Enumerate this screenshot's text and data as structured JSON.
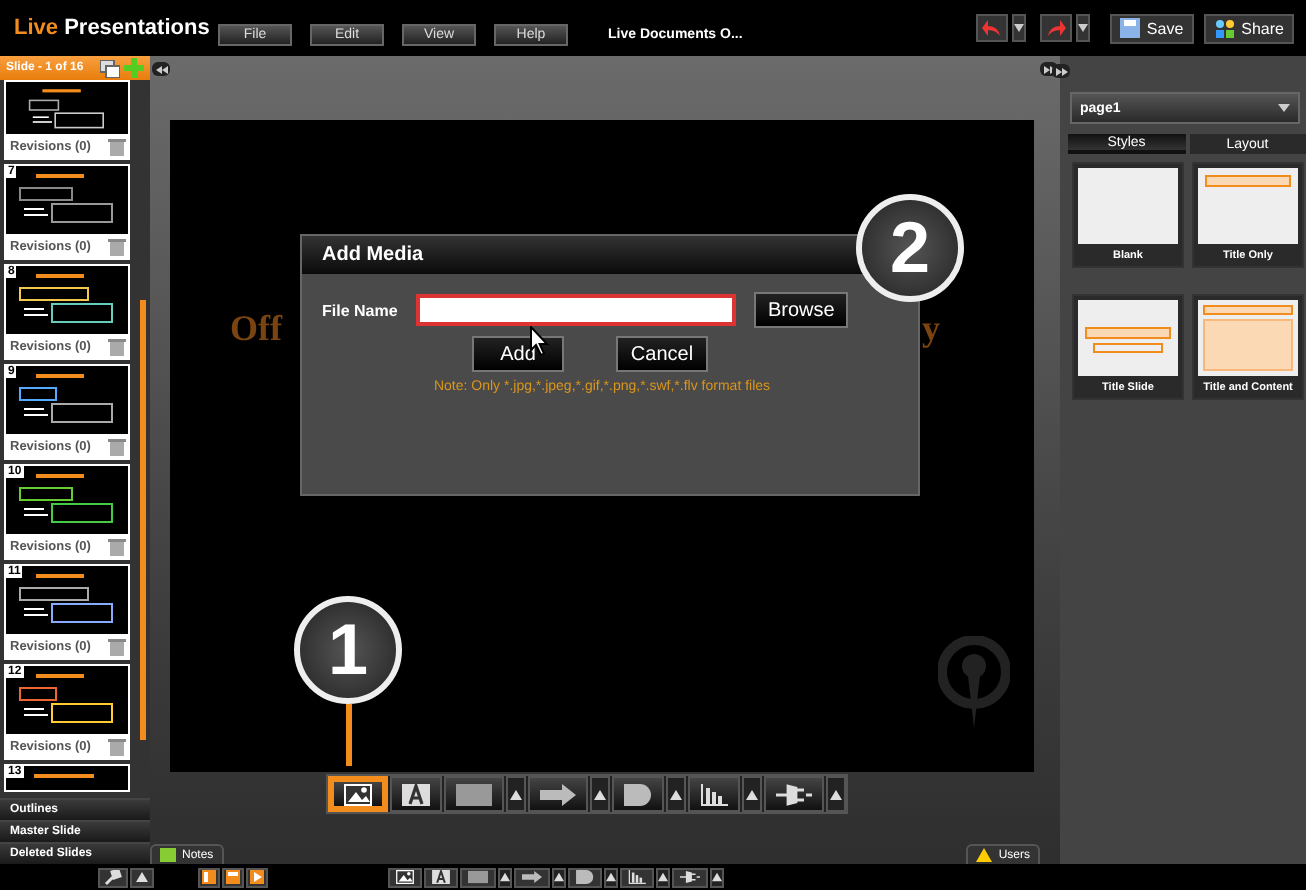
{
  "app": {
    "name_highlight": "Live",
    "name_rest": "Presentations"
  },
  "menu": [
    {
      "label": "File"
    },
    {
      "label": "Edit"
    },
    {
      "label": "View"
    },
    {
      "label": "Help"
    }
  ],
  "document_title": "Live Documents O...",
  "actions": {
    "save": "Save",
    "share": "Share"
  },
  "slides_panel": {
    "header": "Slide - 1 of 16",
    "slides": [
      {
        "revisions": "Revisions (0)"
      },
      {
        "number": "7",
        "revisions": "Revisions (0)"
      },
      {
        "number": "8",
        "revisions": "Revisions (0)"
      },
      {
        "number": "9",
        "revisions": "Revisions (0)"
      },
      {
        "number": "10",
        "revisions": "Revisions (0)"
      },
      {
        "number": "11",
        "revisions": "Revisions (0)"
      },
      {
        "number": "12",
        "revisions": "Revisions (0)"
      },
      {
        "number": "13"
      }
    ],
    "sections": [
      {
        "label": "Outlines"
      },
      {
        "label": "Master Slide"
      },
      {
        "label": "Deleted Slides"
      }
    ]
  },
  "slide": {
    "fragments": [
      {
        "text": "Off"
      },
      {
        "text": "y"
      }
    ]
  },
  "dialog": {
    "title": "Add Media",
    "field_label": "File Name",
    "browse": "Browse",
    "add": "Add",
    "cancel": "Cancel",
    "note": "Note: Only *.jpg,*.jpeg,*.gif,*.png,*.swf,*.flv format files"
  },
  "callouts": [
    {
      "text": "1"
    },
    {
      "text": "2"
    }
  ],
  "insert_toolbar": [
    {
      "kind": "image",
      "selected": true
    },
    {
      "kind": "text",
      "selected": false
    },
    {
      "kind": "rectangle",
      "selected": false
    },
    {
      "kind": "arrow",
      "selected": false
    },
    {
      "kind": "shape",
      "selected": false
    },
    {
      "kind": "chart",
      "selected": false
    },
    {
      "kind": "plug",
      "selected": false
    }
  ],
  "notes_tab": "Notes",
  "users_tab": "Users",
  "right_panel": {
    "page_select": "page1",
    "tabs": [
      {
        "label": "Styles",
        "selected": true
      },
      {
        "label": "Layout",
        "selected": false
      }
    ],
    "layouts": [
      {
        "kind": "blank",
        "label": "Blank"
      },
      {
        "kind": "title_only",
        "label": "Title Only"
      },
      {
        "kind": "title_slide",
        "label": "Title Slide"
      },
      {
        "kind": "title_content",
        "label": "Title and Content"
      }
    ]
  }
}
